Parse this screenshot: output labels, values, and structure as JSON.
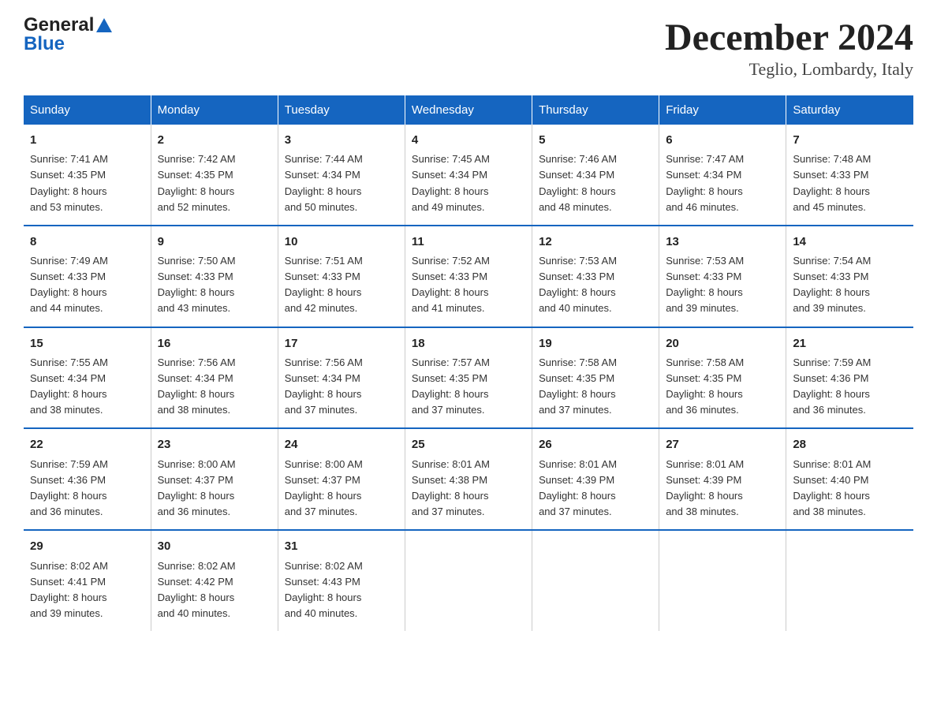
{
  "logo": {
    "general": "General",
    "blue": "Blue"
  },
  "title": "December 2024",
  "subtitle": "Teglio, Lombardy, Italy",
  "days_of_week": [
    "Sunday",
    "Monday",
    "Tuesday",
    "Wednesday",
    "Thursday",
    "Friday",
    "Saturday"
  ],
  "weeks": [
    [
      {
        "day": "1",
        "content": "Sunrise: 7:41 AM\nSunset: 4:35 PM\nDaylight: 8 hours\nand 53 minutes."
      },
      {
        "day": "2",
        "content": "Sunrise: 7:42 AM\nSunset: 4:35 PM\nDaylight: 8 hours\nand 52 minutes."
      },
      {
        "day": "3",
        "content": "Sunrise: 7:44 AM\nSunset: 4:34 PM\nDaylight: 8 hours\nand 50 minutes."
      },
      {
        "day": "4",
        "content": "Sunrise: 7:45 AM\nSunset: 4:34 PM\nDaylight: 8 hours\nand 49 minutes."
      },
      {
        "day": "5",
        "content": "Sunrise: 7:46 AM\nSunset: 4:34 PM\nDaylight: 8 hours\nand 48 minutes."
      },
      {
        "day": "6",
        "content": "Sunrise: 7:47 AM\nSunset: 4:34 PM\nDaylight: 8 hours\nand 46 minutes."
      },
      {
        "day": "7",
        "content": "Sunrise: 7:48 AM\nSunset: 4:33 PM\nDaylight: 8 hours\nand 45 minutes."
      }
    ],
    [
      {
        "day": "8",
        "content": "Sunrise: 7:49 AM\nSunset: 4:33 PM\nDaylight: 8 hours\nand 44 minutes."
      },
      {
        "day": "9",
        "content": "Sunrise: 7:50 AM\nSunset: 4:33 PM\nDaylight: 8 hours\nand 43 minutes."
      },
      {
        "day": "10",
        "content": "Sunrise: 7:51 AM\nSunset: 4:33 PM\nDaylight: 8 hours\nand 42 minutes."
      },
      {
        "day": "11",
        "content": "Sunrise: 7:52 AM\nSunset: 4:33 PM\nDaylight: 8 hours\nand 41 minutes."
      },
      {
        "day": "12",
        "content": "Sunrise: 7:53 AM\nSunset: 4:33 PM\nDaylight: 8 hours\nand 40 minutes."
      },
      {
        "day": "13",
        "content": "Sunrise: 7:53 AM\nSunset: 4:33 PM\nDaylight: 8 hours\nand 39 minutes."
      },
      {
        "day": "14",
        "content": "Sunrise: 7:54 AM\nSunset: 4:33 PM\nDaylight: 8 hours\nand 39 minutes."
      }
    ],
    [
      {
        "day": "15",
        "content": "Sunrise: 7:55 AM\nSunset: 4:34 PM\nDaylight: 8 hours\nand 38 minutes."
      },
      {
        "day": "16",
        "content": "Sunrise: 7:56 AM\nSunset: 4:34 PM\nDaylight: 8 hours\nand 38 minutes."
      },
      {
        "day": "17",
        "content": "Sunrise: 7:56 AM\nSunset: 4:34 PM\nDaylight: 8 hours\nand 37 minutes."
      },
      {
        "day": "18",
        "content": "Sunrise: 7:57 AM\nSunset: 4:35 PM\nDaylight: 8 hours\nand 37 minutes."
      },
      {
        "day": "19",
        "content": "Sunrise: 7:58 AM\nSunset: 4:35 PM\nDaylight: 8 hours\nand 37 minutes."
      },
      {
        "day": "20",
        "content": "Sunrise: 7:58 AM\nSunset: 4:35 PM\nDaylight: 8 hours\nand 36 minutes."
      },
      {
        "day": "21",
        "content": "Sunrise: 7:59 AM\nSunset: 4:36 PM\nDaylight: 8 hours\nand 36 minutes."
      }
    ],
    [
      {
        "day": "22",
        "content": "Sunrise: 7:59 AM\nSunset: 4:36 PM\nDaylight: 8 hours\nand 36 minutes."
      },
      {
        "day": "23",
        "content": "Sunrise: 8:00 AM\nSunset: 4:37 PM\nDaylight: 8 hours\nand 36 minutes."
      },
      {
        "day": "24",
        "content": "Sunrise: 8:00 AM\nSunset: 4:37 PM\nDaylight: 8 hours\nand 37 minutes."
      },
      {
        "day": "25",
        "content": "Sunrise: 8:01 AM\nSunset: 4:38 PM\nDaylight: 8 hours\nand 37 minutes."
      },
      {
        "day": "26",
        "content": "Sunrise: 8:01 AM\nSunset: 4:39 PM\nDaylight: 8 hours\nand 37 minutes."
      },
      {
        "day": "27",
        "content": "Sunrise: 8:01 AM\nSunset: 4:39 PM\nDaylight: 8 hours\nand 38 minutes."
      },
      {
        "day": "28",
        "content": "Sunrise: 8:01 AM\nSunset: 4:40 PM\nDaylight: 8 hours\nand 38 minutes."
      }
    ],
    [
      {
        "day": "29",
        "content": "Sunrise: 8:02 AM\nSunset: 4:41 PM\nDaylight: 8 hours\nand 39 minutes."
      },
      {
        "day": "30",
        "content": "Sunrise: 8:02 AM\nSunset: 4:42 PM\nDaylight: 8 hours\nand 40 minutes."
      },
      {
        "day": "31",
        "content": "Sunrise: 8:02 AM\nSunset: 4:43 PM\nDaylight: 8 hours\nand 40 minutes."
      },
      {
        "day": "",
        "content": ""
      },
      {
        "day": "",
        "content": ""
      },
      {
        "day": "",
        "content": ""
      },
      {
        "day": "",
        "content": ""
      }
    ]
  ]
}
